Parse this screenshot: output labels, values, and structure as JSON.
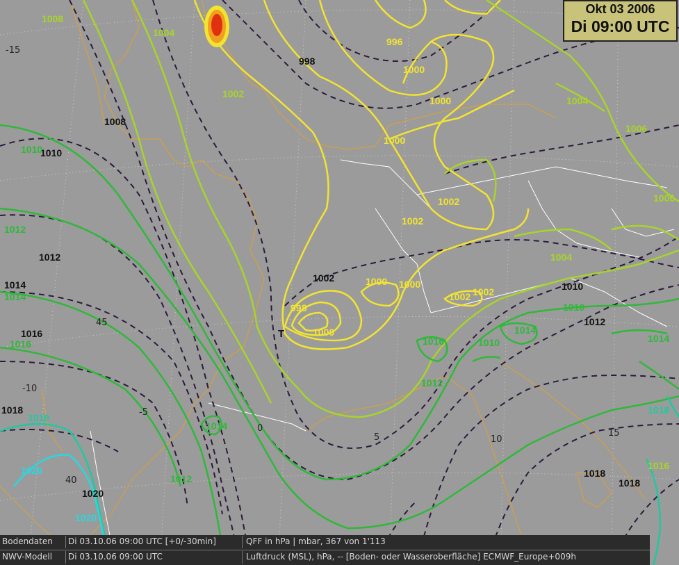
{
  "title": {
    "date": "Okt 03 2006",
    "time": "Di 09:00 UTC"
  },
  "status_rows": [
    {
      "source": "Bodendaten",
      "datetime": "Di 03.10.06 09:00 UTC [+0/-30min]",
      "info": "QFF in hPa | mbar, 367 von 1'113"
    },
    {
      "source": "NWV-Modell",
      "datetime": "Di 03.10.06 09:00 UTC",
      "info": "Luftdruck (MSL), hPa, -- [Boden- oder Wasseroberfläche] ECMWF_Europe+009h"
    }
  ],
  "grid_labels": [
    "-15",
    "-10",
    "-5",
    "0",
    "5",
    "10",
    "15",
    "40",
    "45"
  ],
  "low_marker": "T",
  "isobar_labels": [
    "996",
    "998",
    "1000",
    "1002",
    "1004",
    "1006",
    "1008",
    "1010",
    "1012",
    "1014",
    "1016",
    "1018",
    "1020"
  ],
  "colors": {
    "background": "#9b9b9b",
    "model_isobar": "#2c1a3c",
    "obs_996_1002": "#f2e430",
    "obs_1004_1008": "#a8d42a",
    "obs_1010_1016": "#2fb83a",
    "obs_1018": "#20c8a0",
    "obs_1020": "#28d8e0",
    "coastline": "#e0a030",
    "borders": "#ffffff"
  }
}
